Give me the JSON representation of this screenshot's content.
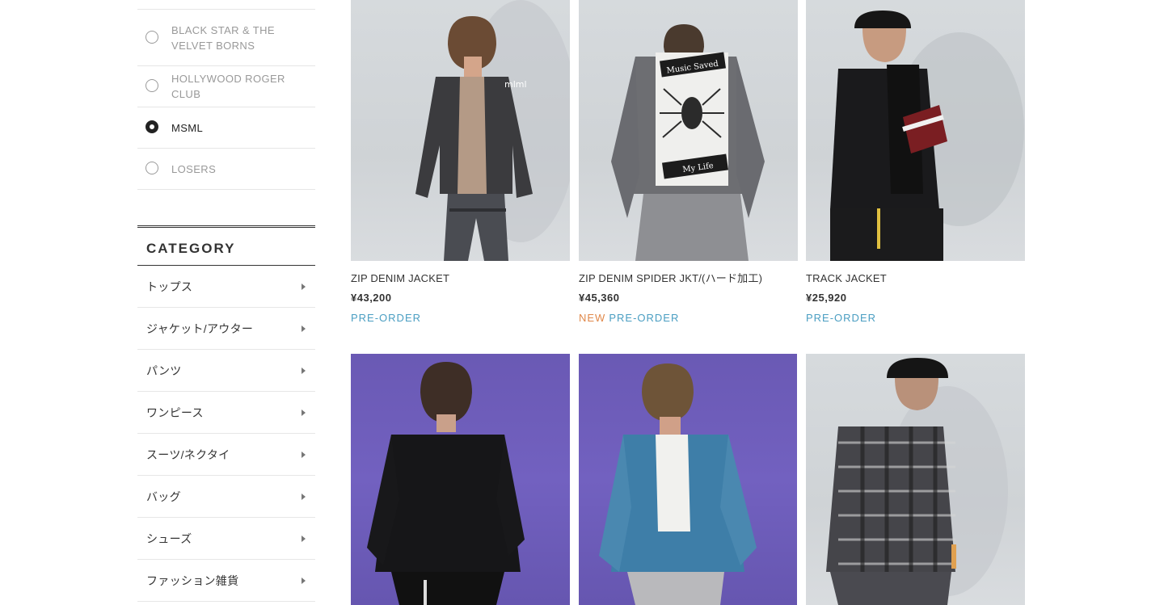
{
  "brands": [
    {
      "label": "BLACK STAR & THE VELVET BORNS",
      "selected": false
    },
    {
      "label": "HOLLYWOOD ROGER CLUB",
      "selected": false
    },
    {
      "label": "MSML",
      "selected": true
    },
    {
      "label": "LOSERS",
      "selected": false
    }
  ],
  "category": {
    "title": "CATEGORY",
    "items": [
      {
        "label": "トップス"
      },
      {
        "label": "ジャケット/アウター"
      },
      {
        "label": "パンツ"
      },
      {
        "label": "ワンピース"
      },
      {
        "label": "スーツ/ネクタイ"
      },
      {
        "label": "バッグ"
      },
      {
        "label": "シューズ"
      },
      {
        "label": "ファッション雑貨"
      }
    ]
  },
  "products": [
    {
      "name": "ZIP DENIM JACKET",
      "price": "¥43,200",
      "new": "",
      "status": "PRE-ORDER"
    },
    {
      "name": "ZIP DENIM SPIDER JKT/(ハード加工)",
      "price": "¥45,360",
      "new": "NEW",
      "status": "PRE-ORDER"
    },
    {
      "name": "TRACK JACKET",
      "price": "¥25,920",
      "new": "",
      "status": "PRE-ORDER"
    },
    {
      "name": "",
      "price": "",
      "new": "",
      "status": ""
    },
    {
      "name": "",
      "price": "",
      "new": "",
      "status": ""
    },
    {
      "name": "",
      "price": "",
      "new": "",
      "status": ""
    }
  ],
  "photo_text": {
    "jacket1_print": "mlml",
    "spider_top": "Music Saved",
    "spider_bottom": "My Life"
  },
  "colors": {
    "new_tag": "#e0884a",
    "preorder_tag": "#4a9ec2",
    "purple_backdrop": "#6a59b4"
  }
}
